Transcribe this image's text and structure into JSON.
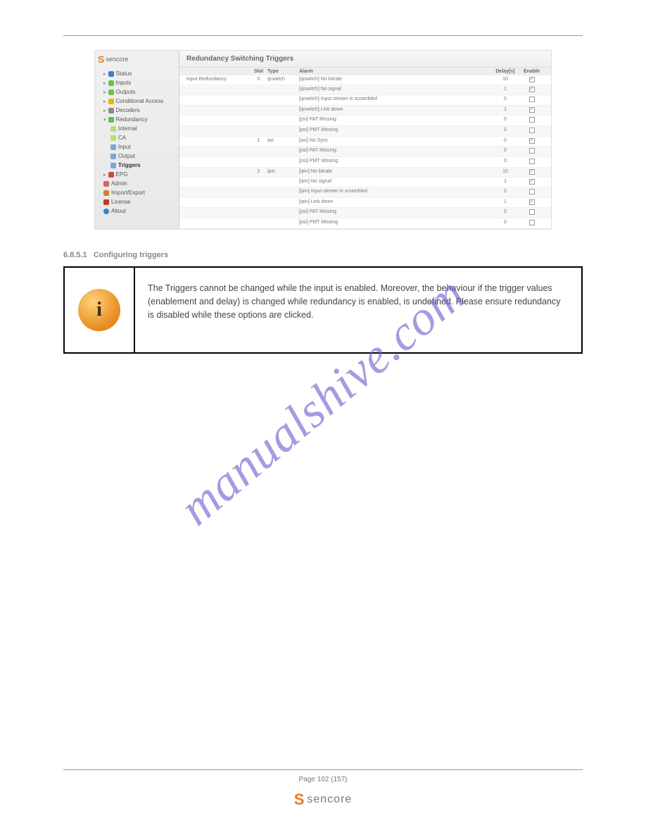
{
  "brand": "sencore",
  "page_title": "Redundancy Switching Triggers",
  "nav": {
    "status": "Status",
    "inputs": "Inputs",
    "outputs": "Outputs",
    "ca": "Conditional Access",
    "decoders": "Decoders",
    "redundancy": "Redundancy",
    "r_internal": "Internal",
    "r_ca": "CA",
    "r_input": "Input",
    "r_output": "Output",
    "r_triggers": "Triggers",
    "epg": "EPG",
    "admin": "Admin",
    "import": "Import/Export",
    "license": "License",
    "about": "About"
  },
  "table": {
    "h_name": "",
    "h_slot": "Slot",
    "h_type": "Type",
    "h_alarm": "Alarm",
    "h_delay": "Delay[s]",
    "h_enable": "Enable",
    "group_name": "Input Redundancy",
    "rows": [
      {
        "slot": "0",
        "type": "ipswitch",
        "alarm": "[ipswitch] No bitrate",
        "delay": "10",
        "en": true
      },
      {
        "slot": "",
        "type": "",
        "alarm": "[ipswitch] No signal",
        "delay": "1",
        "en": true
      },
      {
        "slot": "",
        "type": "",
        "alarm": "[ipswitch] Input stream is scrambled",
        "delay": "0",
        "en": false
      },
      {
        "slot": "",
        "type": "",
        "alarm": "[ipswitch] Link down",
        "delay": "1",
        "en": true
      },
      {
        "slot": "",
        "type": "",
        "alarm": "[psi] PAT Missing",
        "delay": "0",
        "en": false
      },
      {
        "slot": "",
        "type": "",
        "alarm": "[psi] PMT Missing",
        "delay": "0",
        "en": false
      },
      {
        "slot": "1",
        "type": "asi",
        "alarm": "[asi] No Sync",
        "delay": "0",
        "en": true
      },
      {
        "slot": "",
        "type": "",
        "alarm": "[psi] PAT Missing",
        "delay": "0",
        "en": false
      },
      {
        "slot": "",
        "type": "",
        "alarm": "[psi] PMT Missing",
        "delay": "0",
        "en": false
      },
      {
        "slot": "2",
        "type": "ipin",
        "alarm": "[ipin] No bitrate",
        "delay": "10",
        "en": true
      },
      {
        "slot": "",
        "type": "",
        "alarm": "[ipin] No signal",
        "delay": "1",
        "en": true
      },
      {
        "slot": "",
        "type": "",
        "alarm": "[ipin] Input stream is scrambled",
        "delay": "0",
        "en": false
      },
      {
        "slot": "",
        "type": "",
        "alarm": "[ipin] Link down",
        "delay": "1",
        "en": true
      },
      {
        "slot": "",
        "type": "",
        "alarm": "[psi] PAT Missing",
        "delay": "0",
        "en": false
      },
      {
        "slot": "",
        "type": "",
        "alarm": "[psi] PMT Missing",
        "delay": "0",
        "en": false
      }
    ]
  },
  "section_number": "6.8.5.1",
  "section_title": "Configuring triggers",
  "info_text": "The Triggers cannot be changed while the input is enabled. Moreover, the behaviour if the trigger values (enablement and delay) is changed while redundancy is enabled, is undefined. Please ensure redundancy is disabled while these options are clicked.",
  "watermark": "manualshive.com",
  "page_number": "Page 102 (157)",
  "footer_brand": "sencore"
}
